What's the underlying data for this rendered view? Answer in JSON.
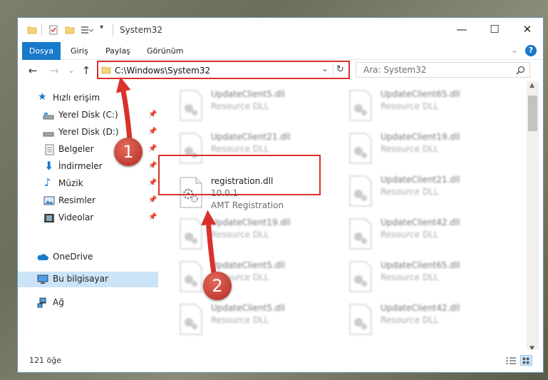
{
  "window": {
    "title": "System32",
    "controls": {
      "minimize": "—",
      "maximize": "☐",
      "close": "✕"
    }
  },
  "ribbon": {
    "tabs": [
      "Dosya",
      "Giriş",
      "Paylaş",
      "Görünüm"
    ],
    "help": "?"
  },
  "address": {
    "path": "C:\\Windows\\System32",
    "search_placeholder": "Ara: System32"
  },
  "nav": {
    "quick_access": "Hızlı erişim",
    "items": [
      {
        "label": "Yerel Disk (C:)",
        "icon": "drive-icon"
      },
      {
        "label": "Yerel Disk (D:)",
        "icon": "drive-icon"
      },
      {
        "label": "Belgeler",
        "icon": "documents-icon"
      },
      {
        "label": "İndirmeler",
        "icon": "downloads-icon"
      },
      {
        "label": "Müzik",
        "icon": "music-icon"
      },
      {
        "label": "Resimler",
        "icon": "pictures-icon"
      },
      {
        "label": "Videolar",
        "icon": "videos-icon"
      }
    ],
    "onedrive": "OneDrive",
    "this_pc": "Bu bilgisayar",
    "network": "Ağ"
  },
  "files": {
    "col1": [
      {
        "name": "UpdateClient5.dll",
        "type": "Resource DLL"
      },
      {
        "name": "UpdateClient21.dll",
        "type": "Resource DLL"
      },
      {
        "name": "registration.dll",
        "version": "10.0.1",
        "type": "AMT Registration"
      },
      {
        "name": "UpdateClient19.dll",
        "type": "Resource DLL"
      },
      {
        "name": "UpdateClient5.dll",
        "type": "Resource DLL"
      },
      {
        "name": "UpdateClient5.dll",
        "type": "Resource DLL"
      }
    ],
    "col2": [
      {
        "name": "UpdateClient65.dll",
        "type": "Resource DLL"
      },
      {
        "name": "UpdateClient19.dll",
        "type": "Resource DLL"
      },
      {
        "name": "UpdateClient21.dll",
        "type": "Resource DLL"
      },
      {
        "name": "UpdateClient42.dll",
        "type": "Resource DLL"
      },
      {
        "name": "UpdateClient65.dll",
        "type": "Resource DLL"
      },
      {
        "name": "UpdateClient42.dll",
        "type": "Resource DLL"
      }
    ]
  },
  "status": {
    "count": "121 öğe"
  },
  "callouts": [
    "1",
    "2"
  ],
  "colors": {
    "accent": "#1979ca",
    "highlight": "#d9312b",
    "selection": "#cce4f7"
  }
}
